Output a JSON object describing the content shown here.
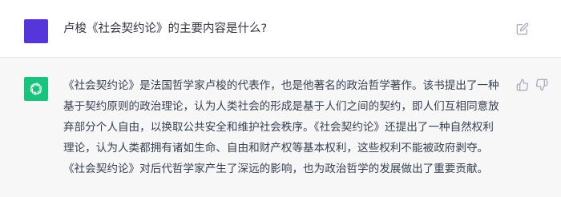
{
  "conversation": {
    "user_message": "卢梭《社会契约论》的主要内容是什么?",
    "assistant_lines": [
      "《社会契约论》是法国哲学家卢梭的代表作，也是他著名的政治哲学著作。该书提出了一种",
      "基于契约原则的政治理论，认为人类社会的形成是基于人们之间的契约，即人们互相同意放",
      "弃部分个人自由，以换取公共安全和维护社会秩序。《社会契约论》还提出了一种自然权利",
      "理论，认为人类都拥有诸如生命、自由和财产权等基本权利，这些权利不能被政府剥夺。",
      "《社会契约论》对后代哲学家产生了深远的影响，也为政治哲学的发展做出了重要贡献。"
    ]
  },
  "icons": {
    "user_avatar": "user-avatar-square",
    "bot_avatar": "chatgpt-logo-icon",
    "edit": "edit-icon",
    "thumbs_up": "thumbs-up-icon",
    "thumbs_down": "thumbs-down-icon"
  },
  "colors": {
    "user_avatar": "#5436da",
    "bot_avatar": "#19c37d",
    "assistant_bg": "#f7f7f8",
    "icon_gray": "#acacbe"
  }
}
